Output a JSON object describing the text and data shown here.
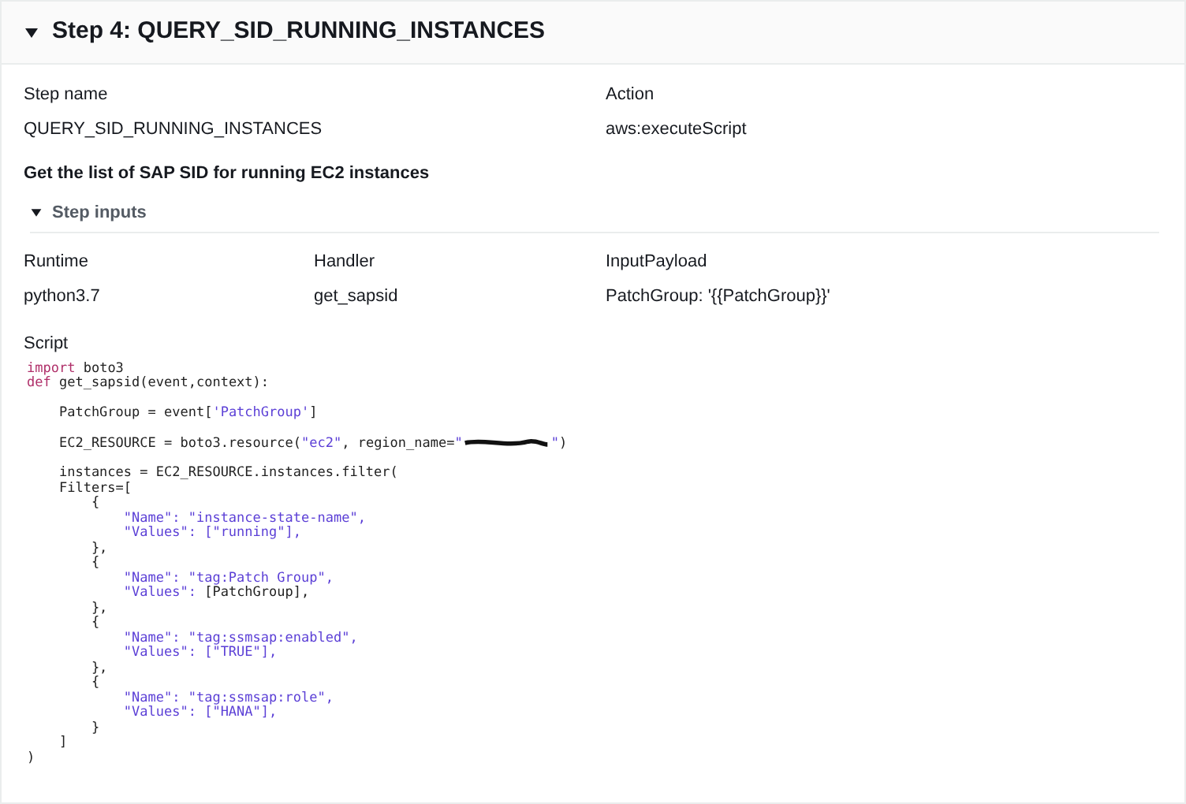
{
  "step": {
    "title": "Step 4: QUERY_SID_RUNNING_INSTANCES",
    "expanded": true
  },
  "details": [
    {
      "label": "Step name",
      "value": "QUERY_SID_RUNNING_INSTANCES"
    },
    {
      "label": "Action",
      "value": "aws:executeScript"
    }
  ],
  "description": "Get the list of SAP SID for running EC2 instances",
  "inputs_section": {
    "title": "Step inputs",
    "expanded": true
  },
  "inputs": [
    {
      "label": "Runtime",
      "value": "python3.7"
    },
    {
      "label": "Handler",
      "value": "get_sapsid"
    },
    {
      "label": "InputPayload",
      "value": "PatchGroup: '{{PatchGroup}}'"
    }
  ],
  "script": {
    "label": "Script",
    "blocks": [
      [
        [
          {
            "kind": "keyword",
            "text": "import"
          },
          {
            "kind": "plain",
            "text": " boto3"
          }
        ],
        [
          {
            "kind": "keyword",
            "text": "def"
          },
          {
            "kind": "plain",
            "text": " get_sapsid(event,context):"
          }
        ]
      ],
      [
        [
          {
            "kind": "plain",
            "text": "    PatchGroup = event["
          },
          {
            "kind": "string",
            "text": "'PatchGroup'"
          },
          {
            "kind": "plain",
            "text": "]"
          }
        ]
      ],
      [
        [
          {
            "kind": "plain",
            "text": "    EC2_RESOURCE = boto3.resource("
          },
          {
            "kind": "string",
            "text": "\"ec2\""
          },
          {
            "kind": "plain",
            "text": ", region_name="
          },
          {
            "kind": "string",
            "text": "\""
          },
          {
            "kind": "redaction"
          },
          {
            "kind": "string",
            "text": "\""
          },
          {
            "kind": "plain",
            "text": ")"
          }
        ]
      ],
      [
        [
          {
            "kind": "plain",
            "text": "    instances = EC2_RESOURCE.instances.filter("
          }
        ],
        [
          {
            "kind": "plain",
            "text": "    Filters=["
          }
        ],
        [
          {
            "kind": "plain",
            "text": "        {"
          }
        ],
        [
          {
            "kind": "string",
            "text": "            \"Name\": \"instance-state-name\","
          }
        ],
        [
          {
            "kind": "string",
            "text": "            \"Values\": [\"running\"],"
          }
        ],
        [
          {
            "kind": "plain",
            "text": "        },"
          }
        ],
        [
          {
            "kind": "plain",
            "text": "        {"
          }
        ],
        [
          {
            "kind": "string",
            "text": "            \"Name\": \"tag:Patch Group\","
          }
        ],
        [
          {
            "kind": "string",
            "text": "            \"Values\": "
          },
          {
            "kind": "plain",
            "text": "[PatchGroup],"
          }
        ],
        [
          {
            "kind": "plain",
            "text": "        },"
          }
        ],
        [
          {
            "kind": "plain",
            "text": "        {"
          }
        ],
        [
          {
            "kind": "string",
            "text": "            \"Name\": \"tag:ssmsap:enabled\","
          }
        ],
        [
          {
            "kind": "string",
            "text": "            \"Values\": [\"TRUE\"],"
          }
        ],
        [
          {
            "kind": "plain",
            "text": "        },"
          }
        ],
        [
          {
            "kind": "plain",
            "text": "        {"
          }
        ],
        [
          {
            "kind": "string",
            "text": "            \"Name\": \"tag:ssmsap:role\","
          }
        ],
        [
          {
            "kind": "string",
            "text": "            \"Values\": [\"HANA\"],"
          }
        ],
        [
          {
            "kind": "plain",
            "text": "        }"
          }
        ],
        [
          {
            "kind": "plain",
            "text": "    ]"
          }
        ],
        [
          {
            "kind": "plain",
            "text": ")"
          }
        ]
      ]
    ]
  }
}
